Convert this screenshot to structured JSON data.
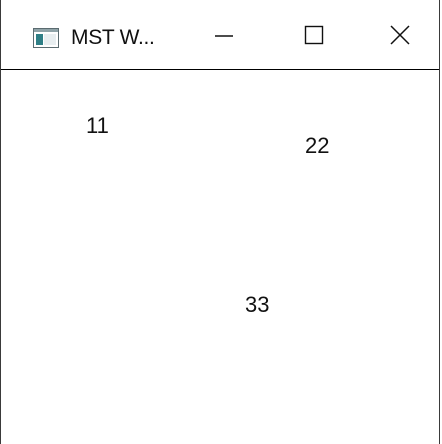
{
  "window": {
    "title": "MST W...",
    "controls": {
      "minimize_icon": "minimize-icon",
      "maximize_icon": "maximize-icon",
      "close_icon": "close-icon"
    },
    "app_icon": "app-window-icon"
  },
  "content": {
    "labels": [
      "11",
      "22",
      "33"
    ]
  },
  "colors": {
    "background": "#ffffff",
    "text": "#111111",
    "titlebar_border": "#000000",
    "window_border": "#3a3a3a",
    "icon_teal": "#2f7f86"
  }
}
